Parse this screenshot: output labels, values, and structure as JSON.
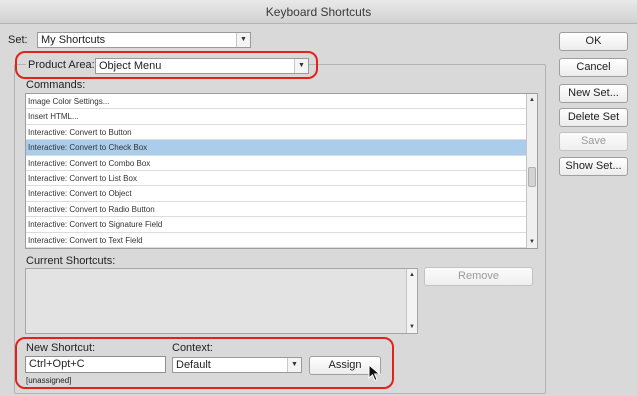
{
  "window": {
    "title": "Keyboard Shortcuts"
  },
  "set": {
    "label": "Set:",
    "value": "My Shortcuts"
  },
  "product_area": {
    "label": "Product Area:",
    "value": "Object Menu"
  },
  "commands": {
    "label": "Commands:",
    "items": [
      "Image Color Settings...",
      "Insert HTML...",
      "Interactive: Convert to Button",
      "Interactive: Convert to Check Box",
      "Interactive: Convert to Combo Box",
      "Interactive: Convert to List Box",
      "Interactive: Convert to Object",
      "Interactive: Convert to Radio Button",
      "Interactive: Convert to Signature Field",
      "Interactive: Convert to Text Field"
    ],
    "selected_index": 3,
    "scroll_position": 0.55
  },
  "current_shortcuts": {
    "label": "Current Shortcuts:",
    "remove_label": "Remove"
  },
  "new_shortcut": {
    "label": "New Shortcut:",
    "value": "Ctrl+Opt+C",
    "status": "[unassigned]"
  },
  "context": {
    "label": "Context:",
    "value": "Default"
  },
  "assign_label": "Assign",
  "buttons": {
    "ok": "OK",
    "cancel": "Cancel",
    "new_set": "New Set...",
    "delete_set": "Delete Set",
    "save": "Save",
    "show_set": "Show Set..."
  },
  "colors": {
    "highlight": "#e0241b",
    "selection": "#a9cdea",
    "window_bg": "#d9d9d9"
  },
  "icons": {
    "dropdown": "chevron-down-icon",
    "scroll_up": "triangle-up-icon",
    "scroll_down": "triangle-down-icon",
    "cursor": "mouse-pointer-icon"
  }
}
